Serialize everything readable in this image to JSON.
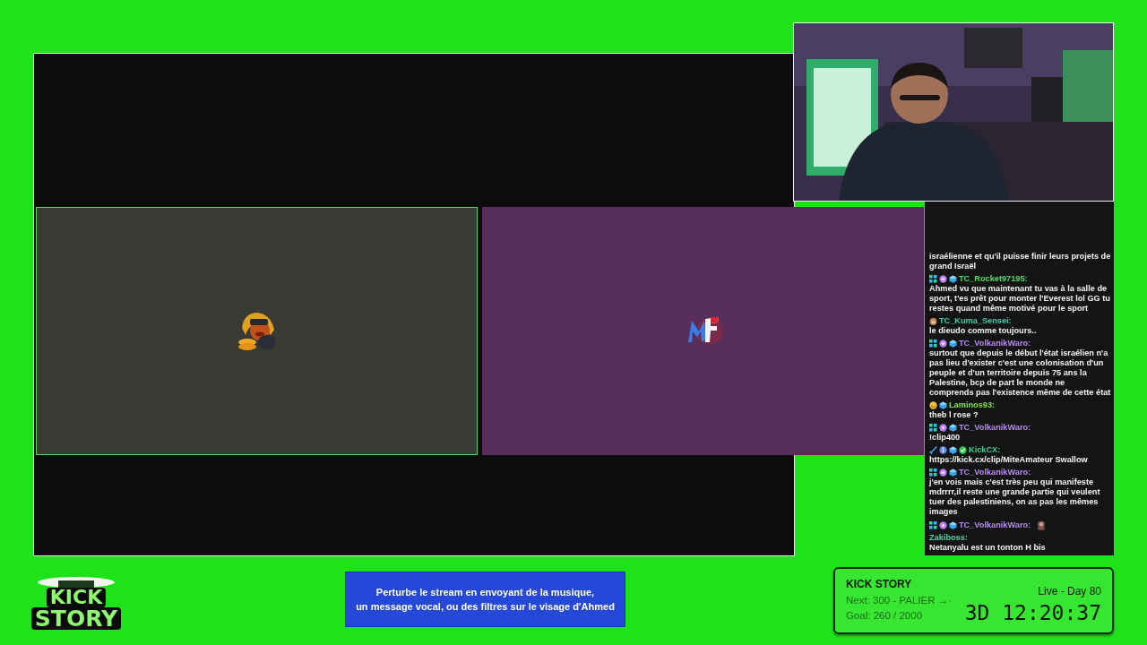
{
  "call": {
    "tiles": [
      {
        "avatar": {
          "kind": "mascot"
        },
        "color": "#393a33",
        "speaking": true
      },
      {
        "avatar": {
          "kind": "monogram"
        },
        "color": "#572e5a",
        "speaking": false
      }
    ]
  },
  "chat": {
    "messages": [
      {
        "text": "israélienne et qu'il puisse finir leurs projets de grand Israël"
      },
      {
        "badges": [
          {
            "kind": "squares"
          },
          {
            "kind": "sub"
          },
          {
            "kind": "cube"
          }
        ],
        "user": "TC_Rocket97195:",
        "color": "#53d86a",
        "text": "Ahmed vu que maintenant tu vas à la salle de sport, t'es prêt pour monter l'Everest lol GG tu restes quand même motivé pour le sport"
      },
      {
        "badges": [
          {
            "kind": "bear"
          }
        ],
        "user": "TC_Kuma_Sensei:",
        "color": "#45c8a8",
        "text": "le dieudo comme toujours.."
      },
      {
        "badges": [
          {
            "kind": "squares"
          },
          {
            "kind": "sub"
          },
          {
            "kind": "cube"
          }
        ],
        "user": "TC_VolkanikWaro:",
        "color": "#b48cf0",
        "text": "surtout que depuis le début l'état israélien n'a pas lieu d'exister c'est une colonisation d'un peuple et d'un territoire depuis 75 ans la Palestine, bcp de part le monde ne comprends pas l'existence même de cette état"
      },
      {
        "badges": [
          {
            "kind": "smiley"
          },
          {
            "kind": "cube"
          }
        ],
        "user": "Laminos93:",
        "color": "#7fe04a",
        "text": "theb l rose ?"
      },
      {
        "badges": [
          {
            "kind": "squares"
          },
          {
            "kind": "sub"
          },
          {
            "kind": "cube"
          }
        ],
        "user": "TC_VolkanikWaro:",
        "color": "#b48cf0",
        "text": "!clip400"
      },
      {
        "badges": [
          {
            "kind": "sword"
          },
          {
            "kind": "info"
          },
          {
            "kind": "cube"
          },
          {
            "kind": "verified"
          }
        ],
        "user": "KickCX:",
        "color": "#3ccf8e",
        "text": "https://kick.cx/clip/MiteAmateur Swallow"
      },
      {
        "badges": [
          {
            "kind": "squares"
          },
          {
            "kind": "sub"
          },
          {
            "kind": "cube"
          }
        ],
        "user": "TC_VolkanikWaro:",
        "color": "#b48cf0",
        "text": "j'en vois mais c'est très peu qui manifeste mdrrrr,il reste une grande partie qui veulent tuer des palestiniens, on as pas les mêmes images"
      },
      {
        "badges": [
          {
            "kind": "squares"
          },
          {
            "kind": "sub"
          },
          {
            "kind": "cube"
          }
        ],
        "user": "TC_VolkanikWaro:",
        "color": "#b48cf0",
        "emote": true
      },
      {
        "user": "Zakiboss:",
        "color": "#4fd3a8",
        "text": "Netanyalu est un tonton H bis"
      }
    ]
  },
  "logo": {
    "line_1": "KICK",
    "line_2": "STORY"
  },
  "banner": {
    "line_1": "Perturbe le stream en envoyant de la musique,",
    "line_2": "un message vocal, ou des filtres sur le visage d'Ahmed"
  },
  "goal_panel": {
    "title": "KICK STORY",
    "next": "Next: 300 - PALIER →·",
    "goal": "Goal: 260 / 2000",
    "live": "Live - Day 80",
    "timer": "3D 12:20:37"
  }
}
